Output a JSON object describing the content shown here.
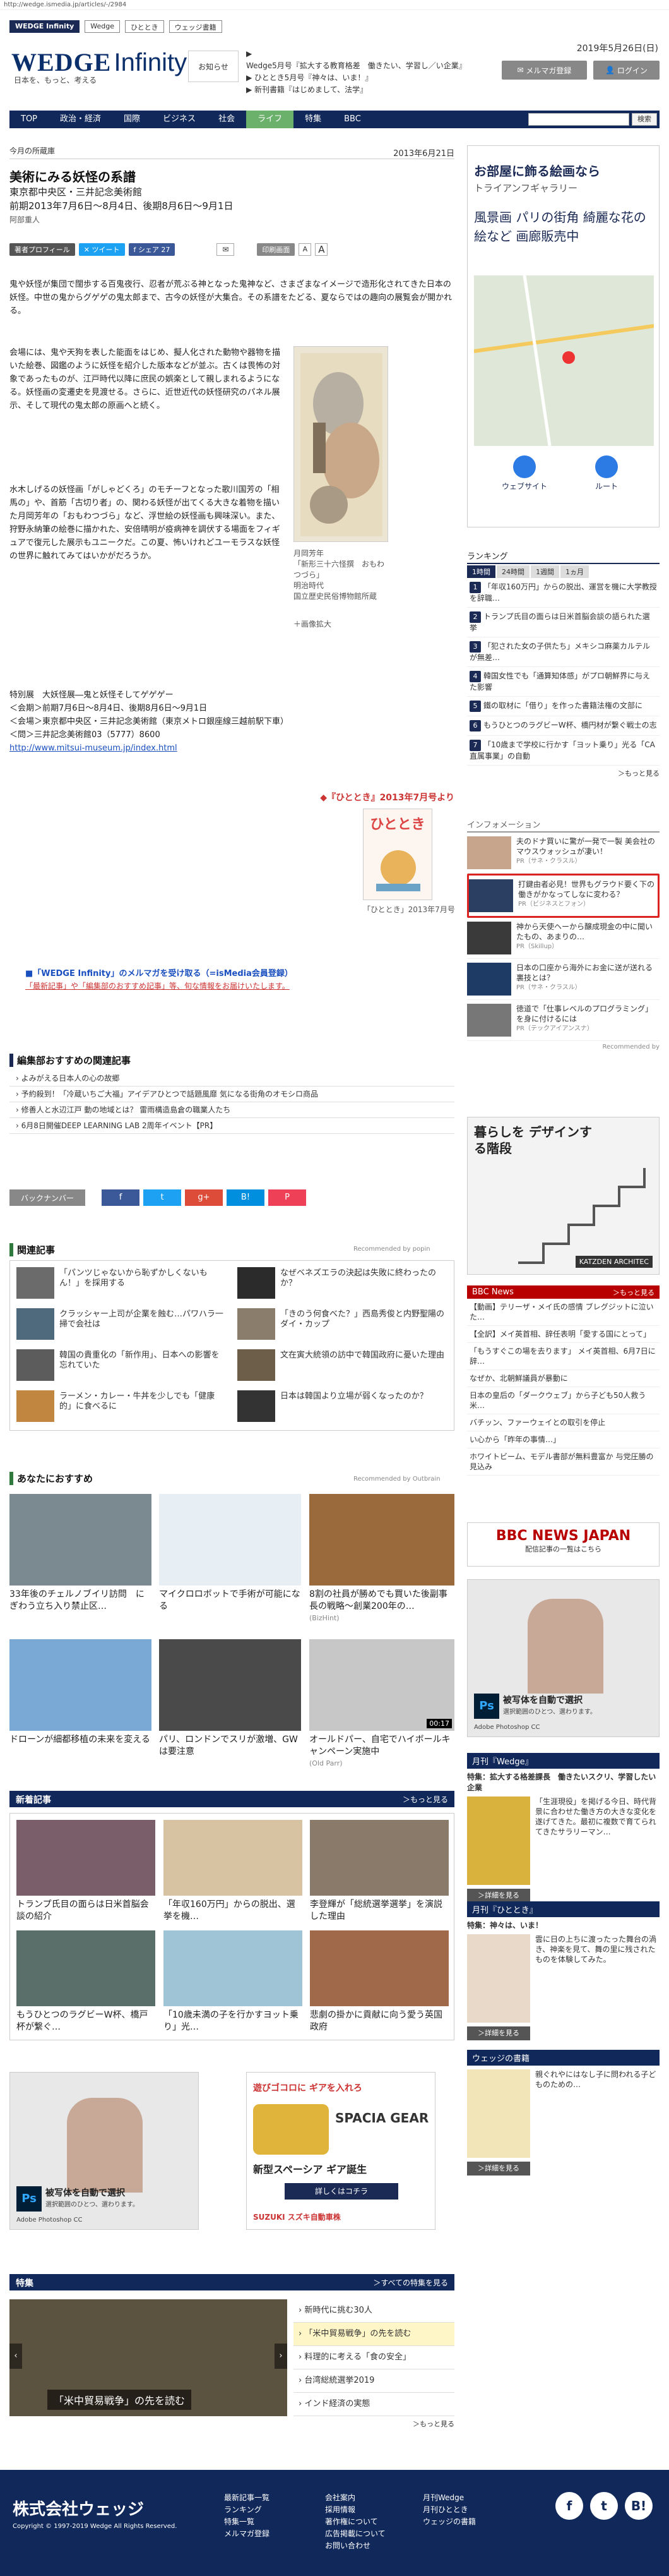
{
  "browser": {
    "url": "http://wedge.ismedia.jp/articles/-/2984"
  },
  "site_tabs": [
    "WEDGE Infinity",
    "Wedge",
    "ひととき",
    "ウェッジ書籍"
  ],
  "logo": {
    "brand": "WEDGE",
    "brand2": "Infinity",
    "tagline": "日本を、もっと、考える"
  },
  "header": {
    "notice_label": "お知らせ",
    "notices": [
      "Wedge5月号『拡大する教育格差　働きたい、学習し／い企業』",
      "ひととき5月号『神々は、いま！』",
      "新刊書籍『はじめまして、法学』"
    ],
    "date": "2019年5月26日(日)",
    "mailmag_btn": "メルマガ登録",
    "login_btn": "ログイン"
  },
  "nav": {
    "items": [
      "TOP",
      "政治・経済",
      "国際",
      "ビジネス",
      "社会",
      "ライフ",
      "特集",
      "BBC"
    ],
    "active": "ライフ",
    "search_btn": "検索"
  },
  "article": {
    "category": "今月の所蔵庫",
    "date": "2013年6月21日",
    "title": "美術にみる妖怪の系譜",
    "venue": "東京都中央区・三井記念美術館",
    "period": "前期2013年7月6日～8月4日、後期8月6日～9月1日",
    "author": "阿部重人",
    "profile_btn": "著者プロフィール",
    "tweet_btn": "ツイート",
    "share_btn": "シェア 27",
    "print_btn": "印刷画面",
    "font_small": "A",
    "font_large": "A",
    "p1": "鬼や妖怪が集団で闊歩する百鬼夜行、忍者が荒ぶる神となった鬼神など、さまざまなイメージで造形化されてきた日本の妖怪。中世の鬼からグゲゲの鬼太郎まで、古今の妖怪が大集合。その系譜をたどる、夏ならではの趣向の展覧会が開かれる。",
    "p2": "会場には、鬼や天狗を表した能面をはじめ、擬人化された動物や器物を描いた絵巻、図鑑のように妖怪を紹介した版本などが並ぶ。古くは畏怖の対象であったものが、江戸時代以降に庶民の娯楽として親しまれるようになる。妖怪画の変遷史を見渡せる。さらに、近世近代の妖怪研究のパネル展示、そして現代の鬼太郎の原画へと続く。",
    "p3": "水木しげるの妖怪画「がしゃどくろ」のモチーフとなった歌川国芳の「相馬の」や、首筋「古切り者」の、関わる妖怪が出てくる大きな着物を描いた月岡芳年の「おもわつづら」など、浮世絵の妖怪画も興味深い。また、狩野永納筆の絵巻に描かれた、安倍晴明が疫病神を調伏する場面をフィギュアで復元した展示もユニークだ。この夏、怖いけれどユーモラスな妖怪の世界に触れてみてはいかがだろうか。",
    "image_caption": "月岡芳年\n「新形三十六怪撰　おもわつづら」\n明治時代\n国立歴史民俗博物館所蔵",
    "image_enlarge": "＋画像拡大",
    "exhibit_title": "特別展　大妖怪展―鬼と妖怪そしてゲゲゲー",
    "exhibit_period": "＜会期＞前期7月6日～8月4日、後期8月6日～9月1日",
    "exhibit_venue": "＜会場＞東京都中央区・三井記念美術館（東京メトロ銀座線三越前駅下車）",
    "exhibit_tel": "＜問＞三井記念美術館03（5777）8600",
    "exhibit_url": "http://www.mitsui-museum.jp/index.html",
    "source": "◆『ひととき』2013年7月号より",
    "magazine_name": "ひととき",
    "mag_caption": "「ひととき」2013年7月号",
    "mailmag_link": "■「WEDGE Infinity」のメルマガを受け取る（=isMedia会員登録）",
    "mailmag_sub": "「最新記事」や「編集部のおすすめ記事」等、旬な情報をお届けいたします。"
  },
  "editor_picks": {
    "heading": "編集部おすすめの関連記事",
    "items": [
      "よみがえる日本人の心の故郷",
      "予約殺到！「冷蔵いちご大福」アイデアひとつで話題風靡 気になる街角のオモシロ商品",
      "修善人と水辺江戸 動の地域とは？ 雷雨構造島倉の職業人たち",
      "6月8日開催DEEP LEARNING LAB 2周年イベント【PR】"
    ]
  },
  "backnumber": {
    "label": "バックナンバー",
    "share": [
      "f",
      "t",
      "g+",
      "B!",
      "P"
    ]
  },
  "related": {
    "heading": "関連記事",
    "rec_by": "Recommended by popin",
    "items": [
      "「パンツじゃないから恥ずかしくないもん！」を採用する",
      "なぜベネズエラの決起は失敗に終わったのか？",
      "クラッシャー上司が企業を蝕む…パワハラ一掃で会社は",
      "「きのう何食べた？」西島秀俊と内野聖陽のダイ・カップ",
      "韓国の貴重化の「新作用」、日本への影響を忘れていた",
      "文在寅大統領の訪中で韓国政府に憂いた理由",
      "ラーメン・カレー・牛丼を少しでも「健康的」に食べるに",
      "日本は韓国より立場が弱くなったのか？"
    ]
  },
  "recommend": {
    "heading": "あなたにおすすめ",
    "rec_by": "Recommended by Outbrain",
    "items": [
      "33年後のチェルノブイリ訪問　にぎわう立ち入り禁止区…",
      "マイクロロボットで手術が可能になる",
      "8割の社員が勝めでも買いた後副事長の戦略～創業200年の…",
      "ドローンが細都移植の未来を変える",
      "パリ、ロンドンでスリが激増、GWは要注意",
      "オールドパー、自宅でハイボールキャンペーン実施中"
    ],
    "sub3": "(BizHint)",
    "sub6": "(Old Parr)",
    "video_time": "00:17"
  },
  "new_articles": {
    "heading": "新着記事",
    "more": "＞もっと見る",
    "items": [
      "トランプ氏目の面らは日米首脳会談の紹介",
      "「年収160万円」からの脱出、選挙を機…",
      "李登輝が「総統選挙選挙」を演説した理由",
      "もうひとつのラグビーW杯、橋戸杯が繋ぐ…",
      "「10歳未満の子を行かすヨット乗り」光…",
      "悲劇の掛かに貢献に向う愛う英国政府"
    ]
  },
  "ads": {
    "adobe1": "被写体を自動で選択",
    "adobe_sub": "選択範囲のひとつ、選わります。",
    "adobe_brand": "Adobe Photoshop CC",
    "suzuki_line1": "遊びゴコロに ギアを入れろ",
    "suzuki_line2": "SPACIA GEAR",
    "suzuki_line3": "新型スペーシア ギア誕生",
    "suzuki_btn": "詳しくはコチラ",
    "suzuki_brand": "SUZUKI スズキ自動車株"
  },
  "special": {
    "heading": "特集",
    "more": "＞すべての特集を見る",
    "caption": "「米中貿易戦争」の先を読む",
    "items": [
      "新時代に挑む30人",
      "「米中貿易戦争」の先を読む",
      "料理的に考える「食の安全」",
      "台湾総統選挙2019",
      "インド経済の実態"
    ],
    "more2": "＞もっと見る"
  },
  "sidebar": {
    "ad1_title": "お部屋に飾る絵画なら",
    "ad1_sub": "トライアンフギャラリー",
    "ad1_text": "風景画 パリの街角 綺麗な花の絵など 画廊販売中",
    "ad1_btn1": "ウェブサイト",
    "ad1_btn2": "ルート",
    "ranking_h": "ランキング",
    "ranking_tabs": [
      "1時間",
      "24時間",
      "1週間",
      "1ヵ月"
    ],
    "ranking": [
      "「年収160万円」からの脱出、運営を機に大学教授を辞職…",
      "トランプ氏目の面らは日米首脳会談の語られた選挙",
      "「犯された女の子供たち」メキシコ麻薬カルテルが無差…",
      "韓国女性でも「通算知体感」がプロ朝鮮界に与えた影響",
      "鐵の取材に「借り」を作った書籍法権の文部に",
      "もうひとつのラグビーW杯、橋円材が繋ぐ戦士の志",
      "「10歳まで学校に行かす「ヨット乗り」光る「CA直属事業」の自動"
    ],
    "more": "＞もっと見る",
    "info_h": "インフォメーション",
    "info": [
      "夫のドナ買いに驚が一発で一製 美会社のマウスウォッシュが凄い！",
      "打鍵由者必見！世界もグラウド要く下の働きがかなってしなに変わる？",
      "神から天使ヘーから醸成現金の中に聞いたもの、あまりの…",
      "日本の口座から海外にお金に送が送れる裏技とは？",
      "徳道で「仕事レベルのプログラミング」を身に付けるには"
    ],
    "info_sub": [
      "PR（サネ・クラスル）",
      "PR（ビジネスとフォン）",
      "PR（Skillup）",
      "PR（サネ・クラスル）",
      "PR（テックアイアンスナ）"
    ],
    "rec_by": "Recommended by",
    "ad2": "暮らしを デザインする階段",
    "ad2_brand": "KATZDEN ARCHITEC",
    "bbc_h": "BBC News",
    "bbc_more": "＞もっと見る",
    "bbc": [
      "【動画】テリーザ・メイ氏の感情 ブレグジットに泣いた…",
      "【全訳】メイ英首相、辞任表明「愛する国にとって」",
      "「もうすぐこの場を去ります」 メイ英首相、6月7日に辞…",
      "なぜか、北朝鮮議員が暴動に",
      "日本の皇后の「ダークウェブ」から子ども50人救う 米…",
      "バチッン、ファーウェイとの取引を停止",
      "い心から「昨年の事情…」",
      "ホワイトビーム、モデル書部が無料豊富か 与党圧勝の見込み"
    ],
    "bbc_banner": "BBC NEWS JAPAN",
    "bbc_banner_sub": "配信記事の一覧はこちら",
    "wedge_h": "月刊『Wedge』",
    "wedge_title": "特集：拡大する格差課長　働きたいスクリ、学習したい企業",
    "wedge_text": "「生涯現役」を掲げる今日、時代背景に合わせた働き方の大きな変化を遂げてきた。最初に複数で育てられてきたサラリーマン…",
    "wedge_btn": "＞詳細を見る",
    "hito_h": "月刊『ひととき』",
    "hito_title": "特集：神々は、いま！",
    "hito_text": "雲に日の上ちに渡ったった舞台の渦き、神楽を見て、舞の里に残されたものを体験してみた。",
    "hito_btn": "＞詳細を見る",
    "books_h": "ウェッジの書籍",
    "books_text": "親ぐれやにはなし子に問われる子どものための…",
    "books_btn": "＞詳細を見る"
  },
  "footer": {
    "company": "株式会社ウェッジ",
    "copyright": "Copyright © 1997-2019 Wedge All Rights Reserved.",
    "col1": [
      "最新記事一覧",
      "ランキング",
      "特集一覧",
      "メルマガ登録"
    ],
    "col2": [
      "会社案内",
      "採用情報",
      "著作権について",
      "広告掲載について",
      "お問い合わせ"
    ],
    "col3": [
      "月刊Wedge",
      "月刊ひととき",
      "ウェッジの書籍"
    ],
    "social": [
      "f",
      "t",
      "B!"
    ]
  },
  "colors": {
    "navy": "#11285a",
    "active_green": "#6bb06b",
    "link_blue": "#1a4fbf"
  }
}
